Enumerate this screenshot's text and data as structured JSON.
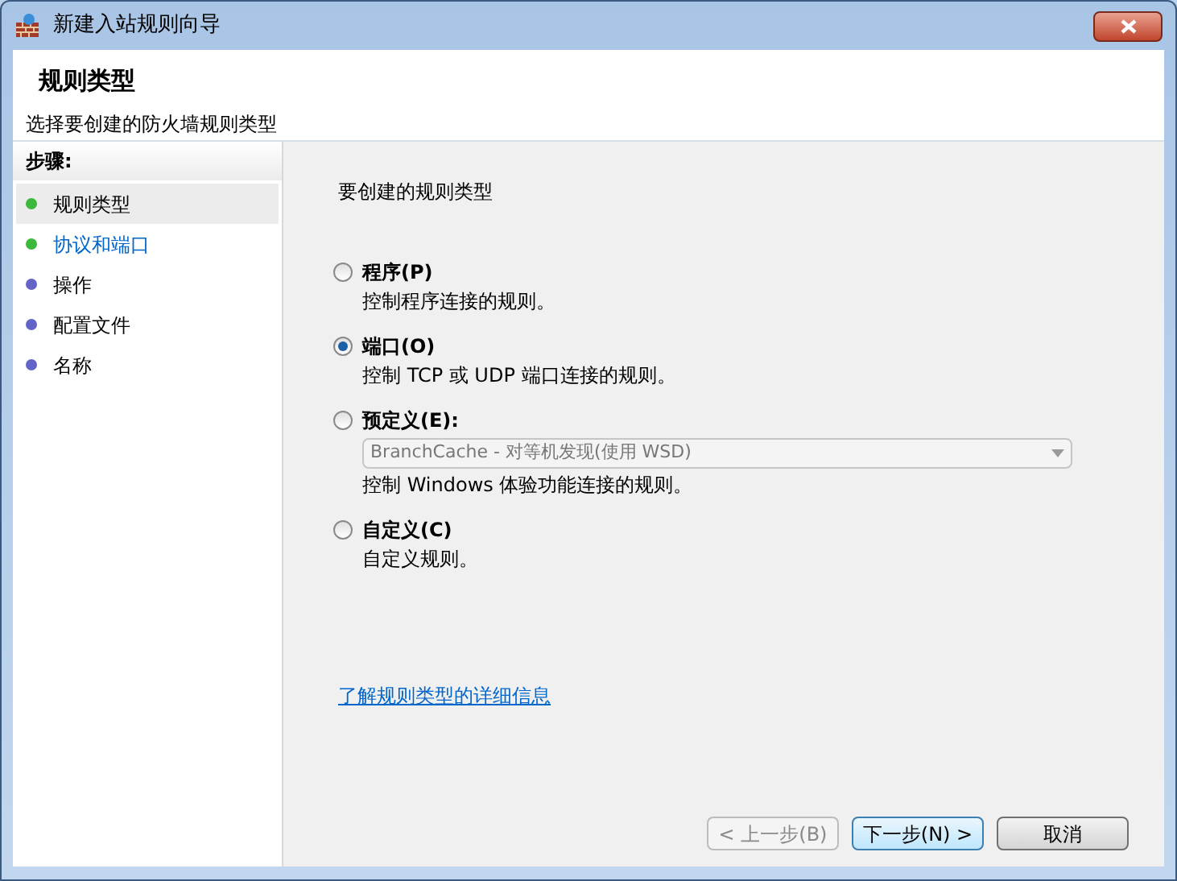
{
  "window": {
    "title": "新建入站规则向导"
  },
  "header": {
    "title": "规则类型",
    "subtitle": "选择要创建的防火墙规则类型"
  },
  "steps": {
    "heading": "步骤:",
    "items": [
      {
        "label": "规则类型",
        "color": "#3cb83c",
        "selected": true,
        "link": false
      },
      {
        "label": "协议和端口",
        "color": "#3cb83c",
        "selected": false,
        "link": true
      },
      {
        "label": "操作",
        "color": "#6464c8",
        "selected": false,
        "link": false
      },
      {
        "label": "配置文件",
        "color": "#6464c8",
        "selected": false,
        "link": false
      },
      {
        "label": "名称",
        "color": "#6464c8",
        "selected": false,
        "link": false
      }
    ]
  },
  "content": {
    "prompt": "要创建的规则类型",
    "options": [
      {
        "label": "程序(P)",
        "description": "控制程序连接的规则。",
        "selected": false
      },
      {
        "label": "端口(O)",
        "description": "控制 TCP 或 UDP 端口连接的规则。",
        "selected": true
      },
      {
        "label": "预定义(E):",
        "description": "控制 Windows 体验功能连接的规则。",
        "selected": false,
        "dropdown": {
          "value": "BranchCache - 对等机发现(使用 WSD)",
          "disabled": true
        }
      },
      {
        "label": "自定义(C)",
        "description": "自定义规则。",
        "selected": false
      }
    ],
    "help_link": "了解规则类型的详细信息"
  },
  "buttons": [
    {
      "label": "< 上一步(B)",
      "disabled": true
    },
    {
      "label": "下一步(N) >",
      "disabled": false,
      "default": true
    },
    {
      "label": "取消",
      "disabled": false
    }
  ]
}
